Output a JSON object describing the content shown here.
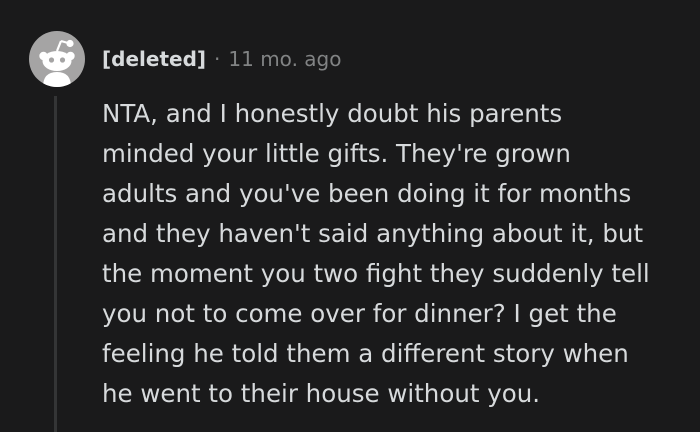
{
  "comment": {
    "author": "[deleted]",
    "separator": "·",
    "timestamp": "11 mo. ago",
    "avatar_icon": "snoo-icon",
    "body_lines": [
      "NTA, and I honestly doubt his parents",
      "minded your little gifts. They're grown",
      "adults and you've been doing it for months",
      "and they haven't said anything about it, but",
      "the moment you two fight they suddenly tell",
      "you not to come over for dinner? I get the",
      "feeling he told them a different story when",
      "he went to their house without you."
    ]
  },
  "colors": {
    "background": "#1a1a1b",
    "text": "#d7dadc",
    "muted": "#818384",
    "avatar_bg": "#a5a4a4",
    "thread_line": "#343536"
  }
}
